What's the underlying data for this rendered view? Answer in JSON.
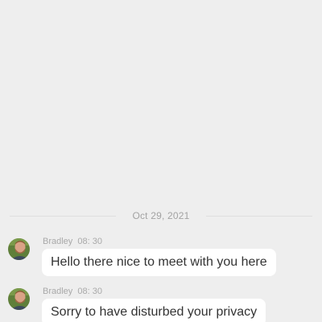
{
  "chat": {
    "date_divider": "Oct 29, 2021",
    "messages": [
      {
        "sender": "Bradley",
        "time": "08: 30",
        "text": "Hello there nice to meet with you here"
      },
      {
        "sender": "Bradley",
        "time": "08: 30",
        "text": "Sorry to have disturbed your privacy"
      }
    ]
  },
  "colors": {
    "background": "#eeeeee",
    "bubble": "#ffffff",
    "meta_text": "#a9a9a9",
    "message_text": "#333333"
  },
  "icons": {
    "avatar": "user-avatar-photo"
  }
}
